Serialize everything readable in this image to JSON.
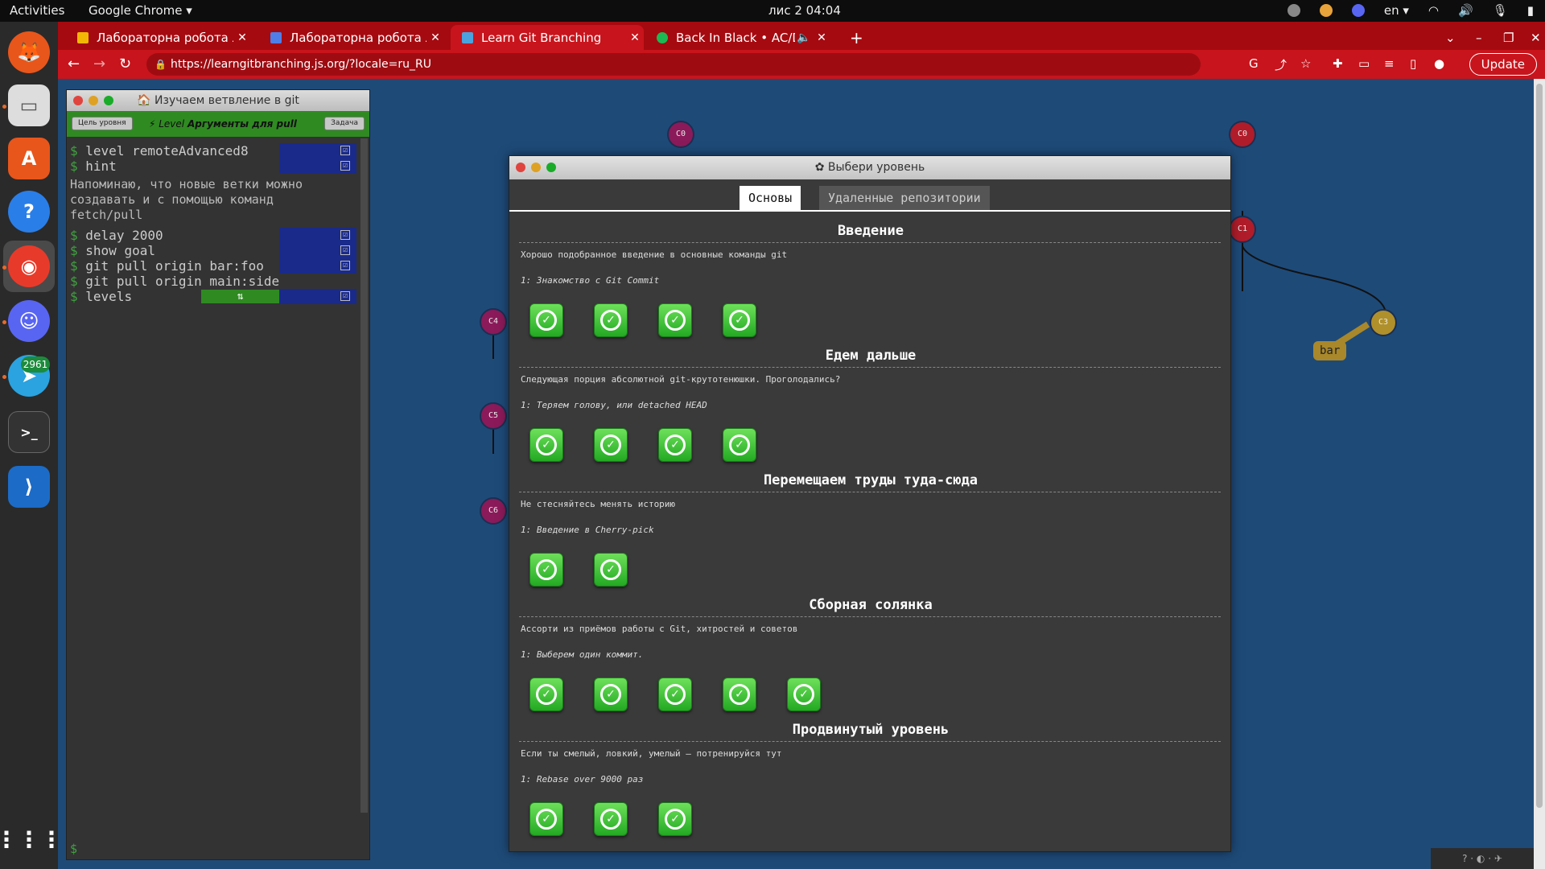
{
  "topbar": {
    "activities": "Activities",
    "app": "Google Chrome ▾",
    "clock": "лис 2  04:04",
    "lang": "en ▾"
  },
  "dock": {
    "telegram_badge": "2961"
  },
  "chrome": {
    "tabs": [
      {
        "title": "Лабораторна робота №",
        "fav_color": "#f2b705"
      },
      {
        "title": "Лабораторна робота №",
        "fav_color": "#4f7ee8"
      },
      {
        "title": "Learn Git Branching",
        "fav_color": "#4aa3df"
      },
      {
        "title": "Back In Black • AC/DC",
        "fav_color": "#1db954"
      }
    ],
    "url": "https://learngitbranching.js.org/?locale=ru_RU",
    "update_label": "Update"
  },
  "terminal": {
    "title": "🏠 Изучаем ветвление в git",
    "goal_btn": "Цель уровня",
    "level_prefix": "⚡ Level",
    "level_name": "Аргументы для pull",
    "task_btn": "Задача",
    "commands": [
      "level remoteAdvanced8",
      "hint",
      "delay 2000",
      "show goal",
      "git pull origin bar:foo",
      "git pull origin main:side",
      "levels"
    ],
    "hint_text": "Напоминаю, что новые ветки можно\nсоздавать и с помощью команд\nfetch/pull",
    "dollar": "$",
    "levels_sync": "⇅",
    "check": "☑"
  },
  "graph": {
    "nodes_left": [
      "C0",
      "C4",
      "C5",
      "C6"
    ],
    "nodes_right": [
      "C0",
      "C1",
      "C3"
    ],
    "branch_bar": "bar"
  },
  "modal": {
    "title": "✿ Выбери уровень",
    "tab_main": "Основы",
    "tab_remote": "Удаленные репозитории",
    "sequences": [
      {
        "title": "Введение",
        "about": "Хорошо подобранное введение в основные команды git",
        "level": "1: Знакомство с Git Commit",
        "done": 4
      },
      {
        "title": "Едем дальше",
        "about": "Следующая порция абсолютной git-крутотенюшки. Проголодались?",
        "level": "1: Теряем голову, или detached HEAD",
        "done": 4
      },
      {
        "title": "Перемещаем труды туда-сюда",
        "about": "Не стесняйтесь менять историю",
        "level": "1: Введение в Cherry-pick",
        "done": 2
      },
      {
        "title": "Сборная солянка",
        "about": "Ассорти из приёмов работы с Git, хитростей и советов",
        "level": "1: Выберем один коммит.",
        "done": 5
      },
      {
        "title": "Продвинутый уровень",
        "about": "Если ты смелый, ловкий, умелый – потренируйся тут",
        "level": "1: Rebase over 9000 раз",
        "done": 3
      }
    ]
  },
  "helpbar": "? · ◐ · ✈",
  "colors": {
    "page_bg": "#1e4a78",
    "chrome_red": "#c8141c",
    "done_green": "#3cc83c"
  }
}
